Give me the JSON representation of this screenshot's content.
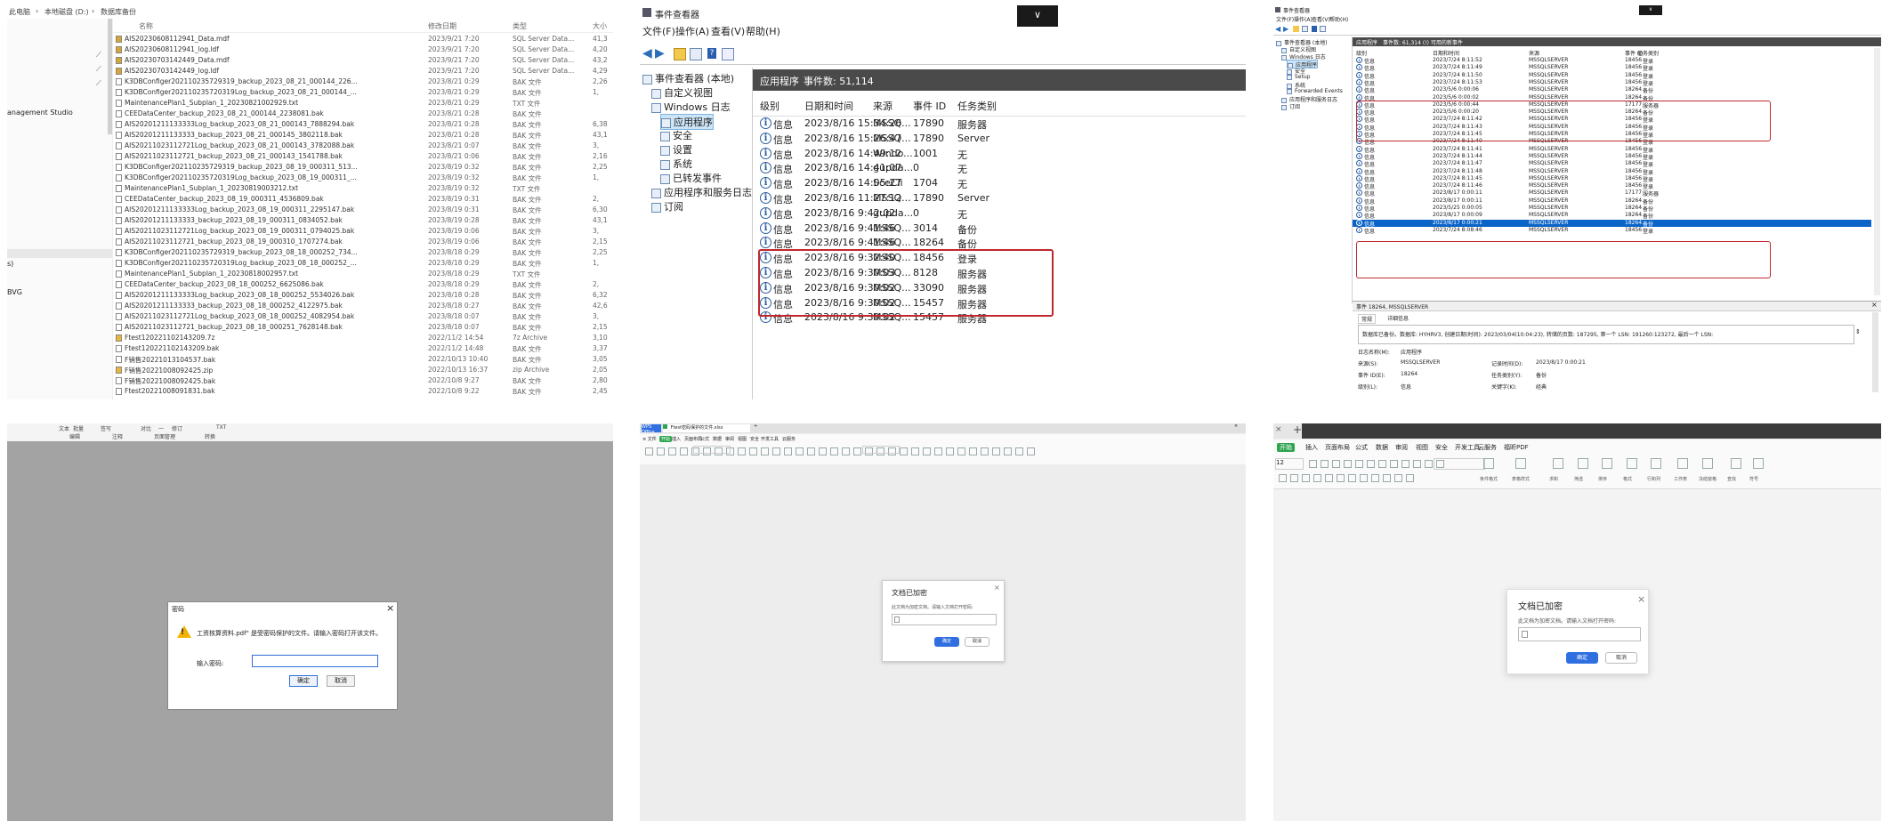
{
  "p1": {
    "breadcrumb": [
      "此电脑",
      "本地磁盘 (D:)",
      "数据库备份"
    ],
    "headers": [
      "名称",
      "修改日期",
      "类型",
      "大小"
    ],
    "sidebar": [
      "anagement Studio",
      "s)",
      "BVG"
    ],
    "files": [
      {
        "name": "AIS20230608112941_Data.mdf",
        "date": "2023/9/21 7:20",
        "type": "SQL Server Data...",
        "size": "41,3",
        "icon": "db"
      },
      {
        "name": "AIS20230608112941_log.ldf",
        "date": "2023/9/21 7:20",
        "type": "SQL Server Data...",
        "size": "4,20",
        "icon": "db"
      },
      {
        "name": "AIS20230703142449_Data.mdf",
        "date": "2023/9/21 7:20",
        "type": "SQL Server Data...",
        "size": "43,2",
        "icon": "db"
      },
      {
        "name": "AIS20230703142449_log.ldf",
        "date": "2023/9/21 7:20",
        "type": "SQL Server Data...",
        "size": "4,29",
        "icon": "db"
      },
      {
        "name": "K3DBConfiger202110235729319_backup_2023_08_21_000144_226...",
        "date": "2023/8/21 0:29",
        "type": "BAK 文件",
        "size": "2,26",
        "icon": "file"
      },
      {
        "name": "K3DBConfiger202110235720319Log_backup_2023_08_21_000144_...",
        "date": "2023/8/21 0:29",
        "type": "BAK 文件",
        "size": "1,",
        "icon": "file"
      },
      {
        "name": "MaintenancePlan1_Subplan_1_20230821002929.txt",
        "date": "2023/8/21 0:29",
        "type": "TXT 文件",
        "size": "",
        "icon": "txt"
      },
      {
        "name": "CEEDataCenter_backup_2023_08_21_000144_2238081.bak",
        "date": "2023/8/21 0:28",
        "type": "BAK 文件",
        "size": "",
        "icon": "file"
      },
      {
        "name": "AIS20201211133333Log_backup_2023_08_21_000143_7888294.bak",
        "date": "2023/8/21 0:28",
        "type": "BAK 文件",
        "size": "6,38",
        "icon": "file"
      },
      {
        "name": "AIS20201211133333_backup_2023_08_21_000145_3802118.bak",
        "date": "2023/8/21 0:28",
        "type": "BAK 文件",
        "size": "43,1",
        "icon": "file"
      },
      {
        "name": "AIS20211023112721Log_backup_2023_08_21_000143_3782088.bak",
        "date": "2023/8/21 0:07",
        "type": "BAK 文件",
        "size": "3,",
        "icon": "file"
      },
      {
        "name": "AIS20211023112721_backup_2023_08_21_000143_1541788.bak",
        "date": "2023/8/21 0:06",
        "type": "BAK 文件",
        "size": "2,16",
        "icon": "file"
      },
      {
        "name": "K3DBConfiger202110235729319_backup_2023_08_19_000311_513...",
        "date": "2023/8/19 0:32",
        "type": "BAK 文件",
        "size": "2,25",
        "icon": "file"
      },
      {
        "name": "K3DBConfiger202110235720319Log_backup_2023_08_19_000311_...",
        "date": "2023/8/19 0:32",
        "type": "BAK 文件",
        "size": "1,",
        "icon": "file"
      },
      {
        "name": "MaintenancePlan1_Subplan_1_20230819003212.txt",
        "date": "2023/8/19 0:32",
        "type": "TXT 文件",
        "size": "",
        "icon": "txt"
      },
      {
        "name": "CEEDataCenter_backup_2023_08_19_000311_4536809.bak",
        "date": "2023/8/19 0:31",
        "type": "BAK 文件",
        "size": "2,",
        "icon": "file"
      },
      {
        "name": "AIS20201211133333Log_backup_2023_08_19_000311_2295147.bak",
        "date": "2023/8/19 0:31",
        "type": "BAK 文件",
        "size": "6,30",
        "icon": "file"
      },
      {
        "name": "AIS20201211133333_backup_2023_08_19_000311_0834052.bak",
        "date": "2023/8/19 0:28",
        "type": "BAK 文件",
        "size": "43,1",
        "icon": "file"
      },
      {
        "name": "AIS20211023112721Log_backup_2023_08_19_000311_0794025.bak",
        "date": "2023/8/19 0:06",
        "type": "BAK 文件",
        "size": "3,",
        "icon": "file"
      },
      {
        "name": "AIS20211023112721_backup_2023_08_19_000310_1707274.bak",
        "date": "2023/8/19 0:06",
        "type": "BAK 文件",
        "size": "2,15",
        "icon": "file"
      },
      {
        "name": "K3DBConfiger202110235729319_backup_2023_08_18_000252_734...",
        "date": "2023/8/18 0:29",
        "type": "BAK 文件",
        "size": "2,25",
        "icon": "file"
      },
      {
        "name": "K3DBConfiger202110235720319Log_backup_2023_08_18_000252_...",
        "date": "2023/8/18 0:29",
        "type": "BAK 文件",
        "size": "1,",
        "icon": "file"
      },
      {
        "name": "MaintenancePlan1_Subplan_1_20230818002957.txt",
        "date": "2023/8/18 0:29",
        "type": "TXT 文件",
        "size": "",
        "icon": "txt"
      },
      {
        "name": "CEEDataCenter_backup_2023_08_18_000252_6625086.bak",
        "date": "2023/8/18 0:29",
        "type": "BAK 文件",
        "size": "2,",
        "icon": "file"
      },
      {
        "name": "AIS20201211133333Log_backup_2023_08_18_000252_5534026.bak",
        "date": "2023/8/18 0:28",
        "type": "BAK 文件",
        "size": "6,32",
        "icon": "file"
      },
      {
        "name": "AIS20201211133333_backup_2023_08_18_000252_4122975.bak",
        "date": "2023/8/18 0:27",
        "type": "BAK 文件",
        "size": "42,6",
        "icon": "file"
      },
      {
        "name": "AIS20211023112721Log_backup_2023_08_18_000252_4082954.bak",
        "date": "2023/8/18 0:07",
        "type": "BAK 文件",
        "size": "3,",
        "icon": "file"
      },
      {
        "name": "AIS20211023112721_backup_2023_08_18_000251_7628148.bak",
        "date": "2023/8/18 0:07",
        "type": "BAK 文件",
        "size": "2,15",
        "icon": "file"
      },
      {
        "name": "Ftest120221102143209.7z",
        "date": "2022/11/2 14:54",
        "type": "7z Archive",
        "size": "3,10",
        "icon": "zip"
      },
      {
        "name": "Ftest120221102143209.bak",
        "date": "2022/11/2 14:48",
        "type": "BAK 文件",
        "size": "3,37",
        "icon": "file"
      },
      {
        "name": "F销售20221013104537.bak",
        "date": "2022/10/13 10:40",
        "type": "BAK 文件",
        "size": "3,05",
        "icon": "file"
      },
      {
        "name": "F销售20221008092425.zip",
        "date": "2022/10/13 16:37",
        "type": "zip Archive",
        "size": "2,05",
        "icon": "zip"
      },
      {
        "name": "F销售20221008092425.bak",
        "date": "2022/10/8 9:27",
        "type": "BAK 文件",
        "size": "2,80",
        "icon": "file"
      },
      {
        "name": "Ftest20221008091831.bak",
        "date": "2022/10/8 9:22",
        "type": "BAK 文件",
        "size": "2,45",
        "icon": "file"
      }
    ]
  },
  "p2": {
    "title": "事件查看器",
    "menu": [
      "文件(F)",
      "操作(A)",
      "查看(V)",
      "帮助(H)"
    ],
    "tree": [
      {
        "label": "事件查看器 (本地)",
        "indent": 0
      },
      {
        "label": "自定义视图",
        "indent": 1
      },
      {
        "label": "Windows 日志",
        "indent": 1
      },
      {
        "label": "应用程序",
        "indent": 2,
        "selected": true
      },
      {
        "label": "安全",
        "indent": 2
      },
      {
        "label": "设置",
        "indent": 2
      },
      {
        "label": "系统",
        "indent": 2
      },
      {
        "label": "已转发事件",
        "indent": 2
      },
      {
        "label": "应用程序和服务日志",
        "indent": 1
      },
      {
        "label": "订阅",
        "indent": 1
      }
    ],
    "header": {
      "log_name": "应用程序",
      "count": "事件数: 51,114"
    },
    "columns": [
      "级别",
      "日期和时间",
      "来源",
      "事件 ID",
      "任务类别"
    ],
    "rows": [
      {
        "level": "信息",
        "datetime": "2023/8/16 15:34:26",
        "source": "MSSQ...",
        "id": "17890",
        "task": "服务器"
      },
      {
        "level": "信息",
        "datetime": "2023/8/16 15:26:47",
        "source": "MSSQ...",
        "id": "17890",
        "task": "Server"
      },
      {
        "level": "信息",
        "datetime": "2023/8/16 14:49:12",
        "source": "Windo...",
        "id": "1001",
        "task": "无"
      },
      {
        "level": "信息",
        "datetime": "2023/8/16 14:41:07",
        "source": "gupda...",
        "id": "0",
        "task": "无"
      },
      {
        "level": "信息",
        "datetime": "2023/8/16 14:05:27",
        "source": "SceCli",
        "id": "1704",
        "task": "无"
      },
      {
        "level": "信息",
        "datetime": "2023/8/16 11:27:12",
        "source": "MSSQ...",
        "id": "17890",
        "task": "Server"
      },
      {
        "level": "信息",
        "datetime": "2023/8/16 9:42:02",
        "source": "gupda...",
        "id": "0",
        "task": "无"
      },
      {
        "level": "信息",
        "datetime": "2023/8/16 9:41:46",
        "source": "MSSQ...",
        "id": "3014",
        "task": "备份"
      },
      {
        "level": "信息",
        "datetime": "2023/8/16 9:41:46",
        "source": "MSSQ...",
        "id": "18264",
        "task": "备份"
      },
      {
        "level": "信息",
        "datetime": "2023/8/16 9:32:40",
        "source": "MSSQ...",
        "id": "18456",
        "task": "登录"
      },
      {
        "level": "信息",
        "datetime": "2023/8/16 9:30:03",
        "source": "MSSQ...",
        "id": "8128",
        "task": "服务器"
      },
      {
        "level": "信息",
        "datetime": "2023/8/16 9:30:02",
        "source": "MSSQ...",
        "id": "33090",
        "task": "服务器"
      },
      {
        "level": "信息",
        "datetime": "2023/8/16 9:30:02",
        "source": "MSSQ...",
        "id": "15457",
        "task": "服务器"
      },
      {
        "level": "信息",
        "datetime": "2023/8/16 9:30:02",
        "source": "MSSQ...",
        "id": "15457",
        "task": "服务器"
      }
    ],
    "chevron": "∨"
  },
  "p3": {
    "title": "事件查看器",
    "menu": [
      "文件(F)",
      "操作(A)",
      "查看(V)",
      "帮助(H)"
    ],
    "tree": [
      {
        "label": "事件查看器 (本地)",
        "indent": 0
      },
      {
        "label": "自定义视图",
        "indent": 1
      },
      {
        "label": "Windows 日志",
        "indent": 1
      },
      {
        "label": "应用程序",
        "indent": 2,
        "selected": true
      },
      {
        "label": "安全",
        "indent": 2
      },
      {
        "label": "Setup",
        "indent": 2
      },
      {
        "label": "系统",
        "indent": 2
      },
      {
        "label": "Forwarded Events",
        "indent": 2
      },
      {
        "label": "应用程序和服务日志",
        "indent": 1
      },
      {
        "label": "订阅",
        "indent": 1
      }
    ],
    "header": {
      "log_name": "应用程序",
      "count": "事件数: 61,314 (!) 可用的新事件"
    },
    "columns": [
      "级别",
      "日期和时间",
      "来源",
      "事件 ID",
      "任务类别"
    ],
    "rows": [
      {
        "level": "信息",
        "datetime": "2023/7/24 8:11:52",
        "source": "MSSQLSERVER",
        "id": "18456",
        "task": "登录"
      },
      {
        "level": "信息",
        "datetime": "2023/7/24 8:11:49",
        "source": "MSSQLSERVER",
        "id": "18456",
        "task": "登录"
      },
      {
        "level": "信息",
        "datetime": "2023/7/24 8:11:50",
        "source": "MSSQLSERVER",
        "id": "18456",
        "task": "登录"
      },
      {
        "level": "信息",
        "datetime": "2023/7/24 8:11:53",
        "source": "MSSQLSERVER",
        "id": "18456",
        "task": "登录"
      },
      {
        "level": "信息",
        "datetime": "2023/5/6 0:00:06",
        "source": "MSSQLSERVER",
        "id": "18264",
        "task": "备份"
      },
      {
        "level": "信息",
        "datetime": "2023/5/6 0:00:02",
        "source": "MSSQLSERVER",
        "id": "18264",
        "task": "备份"
      },
      {
        "level": "信息",
        "datetime": "2023/5/6 0:00:44",
        "source": "MSSQLSERVER",
        "id": "17177",
        "task": "服务器"
      },
      {
        "level": "信息",
        "datetime": "2023/5/6 0:00:20",
        "source": "MSSQLSERVER",
        "id": "18264",
        "task": "备份"
      },
      {
        "level": "信息",
        "datetime": "2023/7/24 8:11:42",
        "source": "MSSQLSERVER",
        "id": "18456",
        "task": "登录"
      },
      {
        "level": "信息",
        "datetime": "2023/7/24 8:11:43",
        "source": "MSSQLSERVER",
        "id": "18456",
        "task": "登录"
      },
      {
        "level": "信息",
        "datetime": "2023/7/24 8:11:45",
        "source": "MSSQLSERVER",
        "id": "18456",
        "task": "登录"
      },
      {
        "level": "信息",
        "datetime": "2023/7/24 8:11:40",
        "source": "MSSQLSERVER",
        "id": "18456",
        "task": "登录"
      },
      {
        "level": "信息",
        "datetime": "2023/7/24 8:11:41",
        "source": "MSSQLSERVER",
        "id": "18456",
        "task": "登录"
      },
      {
        "level": "信息",
        "datetime": "2023/7/24 8:11:44",
        "source": "MSSQLSERVER",
        "id": "18456",
        "task": "登录"
      },
      {
        "level": "信息",
        "datetime": "2023/7/24 8:11:47",
        "source": "MSSQLSERVER",
        "id": "18456",
        "task": "登录"
      },
      {
        "level": "信息",
        "datetime": "2023/7/24 8:11:48",
        "source": "MSSQLSERVER",
        "id": "18456",
        "task": "登录"
      },
      {
        "level": "信息",
        "datetime": "2023/7/24 8:11:45",
        "source": "MSSQLSERVER",
        "id": "18456",
        "task": "登录"
      },
      {
        "level": "信息",
        "datetime": "2023/7/24 8:11:46",
        "source": "MSSQLSERVER",
        "id": "18456",
        "task": "登录"
      },
      {
        "level": "信息",
        "datetime": "2023/8/17 0:00:11",
        "source": "MSSQLSERVER",
        "id": "17177",
        "task": "服务器"
      },
      {
        "level": "信息",
        "datetime": "2023/8/17 0:00:11",
        "source": "MSSQLSERVER",
        "id": "18264",
        "task": "备份"
      },
      {
        "level": "信息",
        "datetime": "2023/5/25 0:00:05",
        "source": "MSSQLSERVER",
        "id": "18264",
        "task": "备份"
      },
      {
        "level": "信息",
        "datetime": "2023/8/17 0:00:09",
        "source": "MSSQLSERVER",
        "id": "18264",
        "task": "备份"
      },
      {
        "level": "信息",
        "datetime": "2023/8/17 0:00:21",
        "source": "MSSQLSERVER",
        "id": "18264",
        "task": "备份",
        "selected": true
      },
      {
        "level": "信息",
        "datetime": "2023/7/24 8:08:46",
        "source": "MSSQLSERVER",
        "id": "18456",
        "task": "登录"
      }
    ],
    "detail": {
      "title": "事件 18264, MSSQLSERVER",
      "close": "×",
      "tabs": [
        "常规",
        "详细信息"
      ],
      "message": "数据库已备份。数据库: HYHRV3, 创建日期(时间): 2023/03/04(10:04:23), 转储的页数: 187295, 第一个 LSN: 191260:123272, 最后一个 LSN:",
      "fields": [
        {
          "label": "日志名称(M):",
          "value": "应用程序",
          "label2": "",
          "value2": ""
        },
        {
          "label": "来源(S):",
          "value": "MSSQLSERVER",
          "label2": "记录时间(D):",
          "value2": "2023/8/17 0:00:21"
        },
        {
          "label": "事件 ID(E):",
          "value": "18264",
          "label2": "任务类别(Y):",
          "value2": "备份"
        },
        {
          "label": "级别(L):",
          "value": "信息",
          "label2": "关键字(K):",
          "value2": "经典"
        }
      ]
    },
    "chevron": "∨"
  },
  "p4": {
    "ribbon_top": [
      "文本",
      "批量",
      "签写",
      "对比",
      "一",
      "修订",
      "TXT"
    ],
    "ribbon_groups": [
      "编辑",
      "注释",
      "页面管理",
      "转换"
    ],
    "dialog": {
      "title": "密码",
      "close": "×",
      "message": "工资核算资料.pdf\" 是受密码保护的文件。请输入密码打开该文件。",
      "label": "输入密码:",
      "ok": "确定",
      "cancel": "取消"
    }
  },
  "p5": {
    "tabs": [
      "WPS Office",
      "Ftest密码保护的文件.xlsx"
    ],
    "menu": [
      "≡ 文件",
      "开始",
      "插入",
      "页面布局",
      "公式",
      "数据",
      "审阅",
      "视图",
      "安全",
      "开发工具",
      "云服务"
    ],
    "dialog": {
      "title": "文档已加密",
      "close": "×",
      "message": "此文档为加密文档。请输入文档打开密码:",
      "ok": "确定",
      "cancel": "取消"
    }
  },
  "p6": {
    "menu": [
      "开始",
      "插入",
      "页面布局",
      "公式",
      "数据",
      "审阅",
      "视图",
      "安全",
      "开发工具",
      "云服务",
      "福昕PDF"
    ],
    "fontsize": "12",
    "toolbar": [
      "条件格式",
      "表格样式",
      "求和",
      "筛选",
      "排序",
      "格式",
      "行和列",
      "工作表",
      "冻结窗格",
      "查找",
      "符号"
    ],
    "dialog": {
      "title": "文档已加密",
      "close": "×",
      "message": "此文档为加密文档。请输入文档打开密码:",
      "ok": "确定",
      "cancel": "取消"
    }
  }
}
